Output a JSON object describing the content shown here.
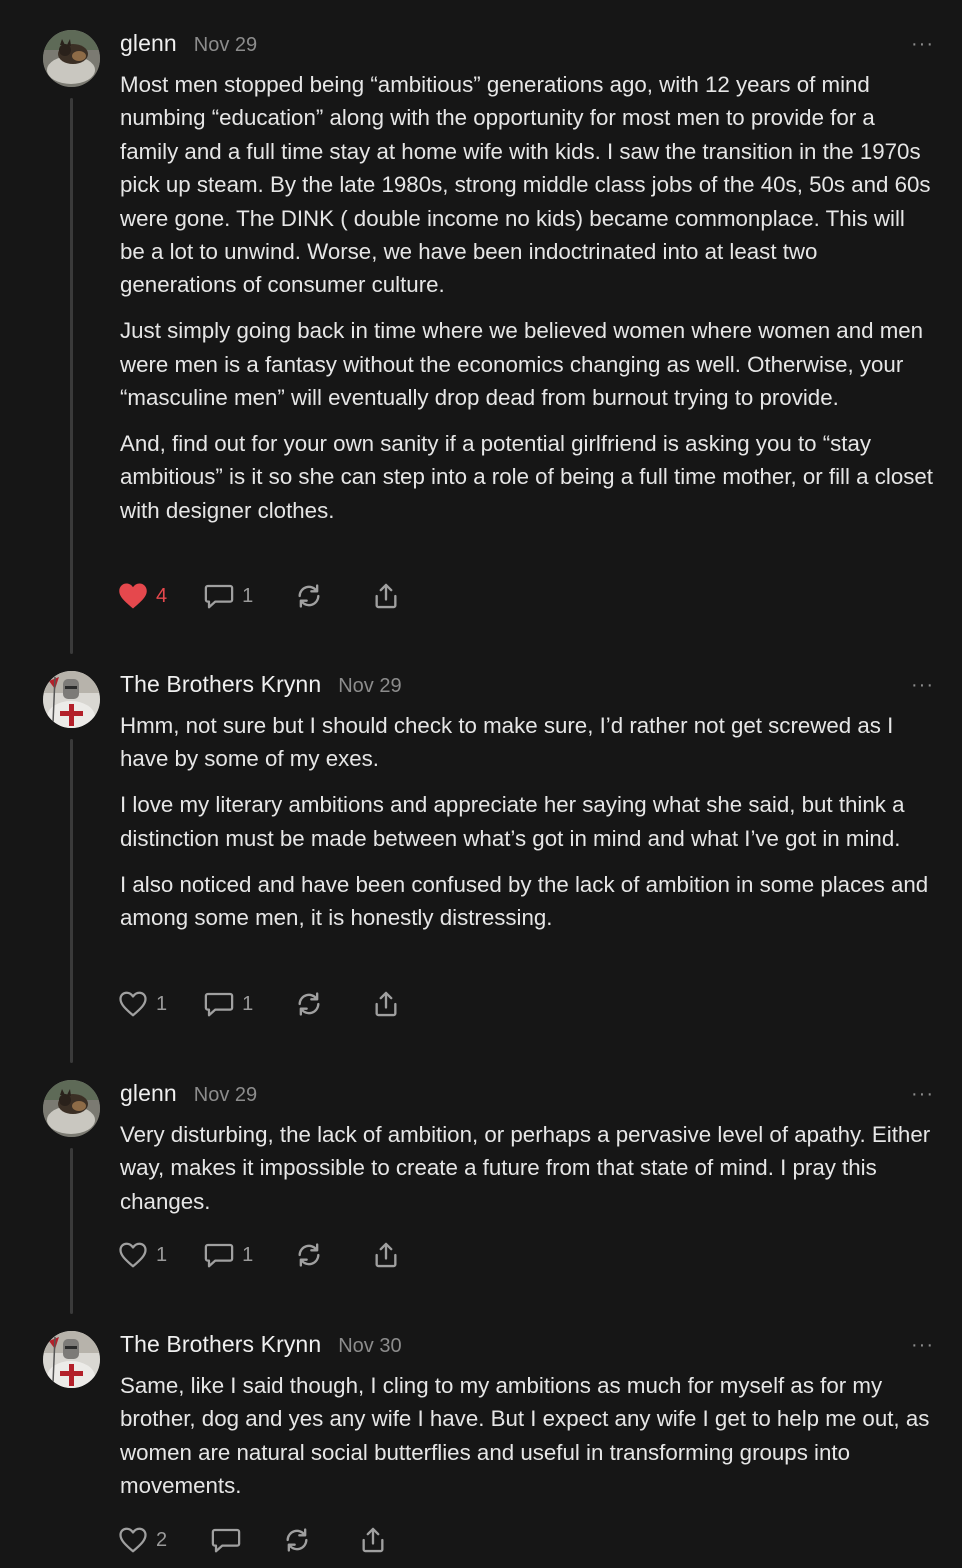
{
  "comments": [
    {
      "author": "glenn",
      "date": "Nov 29",
      "more": "···",
      "paragraphs": [
        "Most men stopped being “ambitious” generations ago, with 12 years of mind numbing “education” along with the opportunity for most men to provide for a family and a full time stay at home wife with kids. I saw the transition in the 1970s pick up steam. By the late 1980s, strong middle class jobs of the 40s, 50s and 60s were gone. The DINK ( double income no kids) became commonplace. This will be a lot to unwind. Worse, we have been indoctrinated into at least two generations of consumer culture.",
        "Just simply going back in time where we believed women where women and men were men is a fantasy without the economics changing as well. Otherwise, your “masculine men” will eventually drop dead from burnout trying to provide.",
        "And, find out for your own sanity if a potential girlfriend is asking you to “stay ambitious” is it so she can step into a role of being a full time mother, or fill a closet with designer clothes."
      ],
      "likes": "4",
      "liked": true,
      "replies": "1"
    },
    {
      "author": "The Brothers Krynn",
      "date": "Nov 29",
      "more": "···",
      "paragraphs": [
        "Hmm, not sure but I should check to make sure, I’d rather not get screwed as I have by some of my exes.",
        "I love my literary ambitions and appreciate her saying what she said, but think a distinction must be made between what’s got in mind and what I’ve got in mind.",
        "I also noticed and have been confused by the lack of ambition in some places and among some men, it is honestly distressing."
      ],
      "likes": "1",
      "liked": false,
      "replies": "1"
    },
    {
      "author": "glenn",
      "date": "Nov 29",
      "more": "···",
      "paragraphs": [
        "Very disturbing, the lack of ambition, or perhaps a pervasive level of apathy. Either way, makes it impossible to create a future from that state of mind. I pray this changes."
      ],
      "likes": "1",
      "liked": false,
      "replies": "1"
    },
    {
      "author": "The Brothers Krynn",
      "date": "Nov 30",
      "more": "···",
      "paragraphs": [
        "Same, like I said though, I cling to my ambitions as much for myself as for my brother, dog and yes any wife I have. But I expect any wife I get to help me out, as women are natural social butterflies and useful in transforming groups into movements."
      ],
      "likes": "2",
      "liked": false,
      "replies": ""
    }
  ],
  "icons": {
    "avatar_glenn": "cat-photo-avatar",
    "avatar_krynn": "knight-crusader-avatar",
    "like": "heart-icon",
    "reply": "speech-bubble-icon",
    "restack": "restack-icon",
    "share": "share-icon",
    "more": "ellipsis-icon"
  },
  "colors": {
    "background": "#161616",
    "text": "#e6e6e6",
    "muted": "#8c8c8c",
    "liked": "#e5484d",
    "thread_line": "#3a3a3a"
  }
}
